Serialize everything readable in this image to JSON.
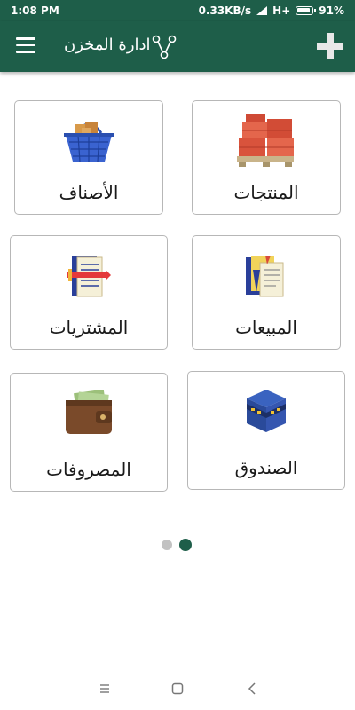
{
  "status_bar": {
    "time": "1:08 PM",
    "network_speed": "0.33KB/s",
    "signal": "H+",
    "battery": "91%"
  },
  "app_bar": {
    "title": "ادارة المخزن",
    "menu_icon": "hamburger-menu-icon",
    "share_icon": "share-icon",
    "add_icon": "plus-icon"
  },
  "tiles": [
    {
      "label": "المنتجات",
      "icon": "boxes-on-pallet-icon"
    },
    {
      "label": "الأصناف",
      "icon": "shopping-basket-icon"
    },
    {
      "label": "المبيعات",
      "icon": "sales-documents-icon"
    },
    {
      "label": "المشتريات",
      "icon": "purchase-documents-icon"
    },
    {
      "label": "الصندوق",
      "icon": "cash-box-icon"
    },
    {
      "label": "المصروفات",
      "icon": "wallet-icon"
    }
  ],
  "pager": {
    "count": 2,
    "active_index": 1
  },
  "colors": {
    "primary": "#1e5e49",
    "dot_inactive": "#c2c2c2"
  },
  "nav_bar": {
    "icons": [
      "recent-apps-icon",
      "home-icon",
      "back-icon"
    ]
  }
}
